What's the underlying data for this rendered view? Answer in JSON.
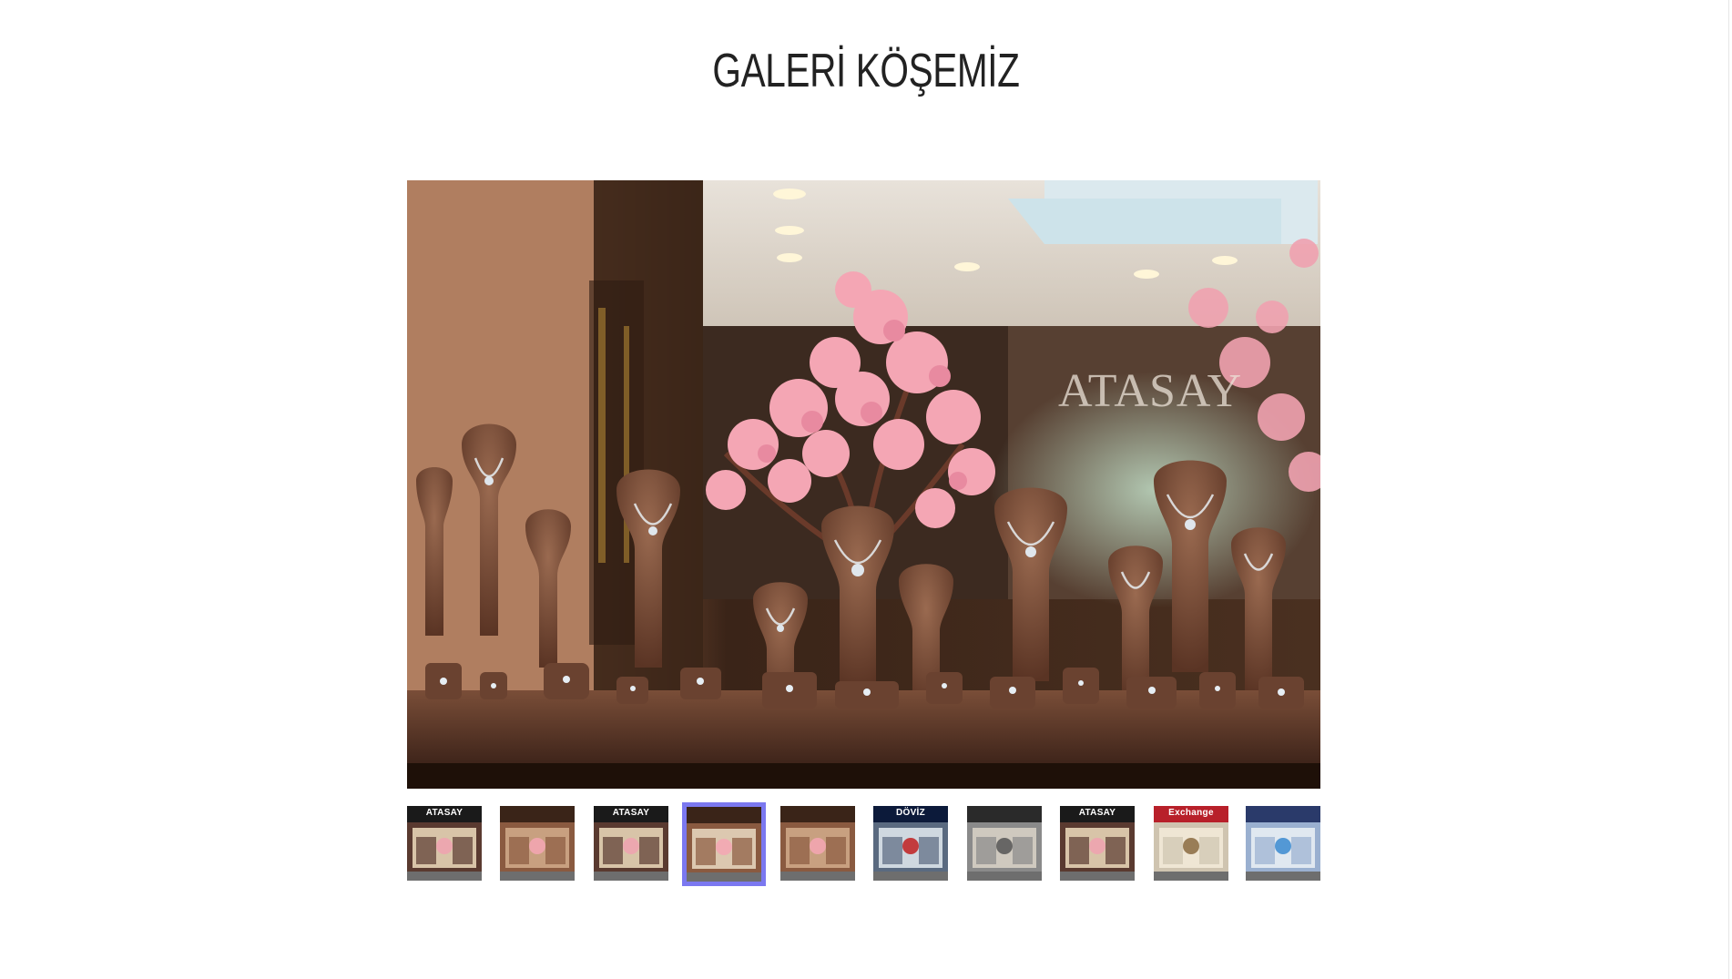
{
  "section": {
    "title": "GALERİ KÖŞEMİZ"
  },
  "gallery": {
    "main_image": {
      "alt": "Atasay jewelry shop window display",
      "sign_text": "ATASAY"
    },
    "active_index": 3,
    "thumbnails": [
      {
        "name": "thumb-storefront-1",
        "label": "ATASAY",
        "theme": "storefront"
      },
      {
        "name": "thumb-display-1",
        "label": "",
        "theme": "display"
      },
      {
        "name": "thumb-storefront-2",
        "label": "ATASAY",
        "theme": "storefront"
      },
      {
        "name": "thumb-window",
        "label": "",
        "theme": "window"
      },
      {
        "name": "thumb-display-2",
        "label": "",
        "theme": "display"
      },
      {
        "name": "thumb-doviz",
        "label": "DÖVİZ",
        "theme": "exchange"
      },
      {
        "name": "thumb-storefront-3",
        "label": "",
        "theme": "street"
      },
      {
        "name": "thumb-storefront-4",
        "label": "ATASAY",
        "theme": "storefront"
      },
      {
        "name": "thumb-exchange-1",
        "label": "Exchange",
        "theme": "exchange-red"
      },
      {
        "name": "thumb-exchange-2",
        "label": "",
        "theme": "exchange-blue"
      }
    ]
  },
  "colors": {
    "active_border": "#7b78f0",
    "title": "#222222"
  }
}
